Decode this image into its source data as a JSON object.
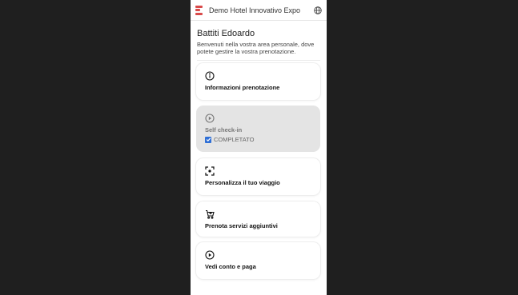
{
  "header": {
    "title": "Demo Hotel Innovativo Expo",
    "logo_icon": "hotel-logo-icon",
    "language_icon": "globe-icon"
  },
  "greeting": {
    "name": "Battiti Edoardo",
    "message": "Benvenuti nella vostra area personale, dove potete gestire la vostra prenotazione."
  },
  "cards": [
    {
      "label": "Informazioni prenotazione",
      "icon": "info-icon"
    },
    {
      "label": "Self check-in",
      "icon": "play-circle-icon",
      "status": "COMPLETATO",
      "disabled": true
    },
    {
      "label": "Personalizza il tuo viaggio",
      "icon": "focus-icon"
    },
    {
      "label": "Prenota servizi aggiuntivi",
      "icon": "cart-icon"
    },
    {
      "label": "Vedi conto e paga",
      "icon": "play-circle-icon"
    }
  ],
  "colors": {
    "background": "#1f1f1f",
    "accent": "#2f6fd6",
    "logo": "#d94a4a",
    "disabled_card": "#e4e4e4"
  }
}
